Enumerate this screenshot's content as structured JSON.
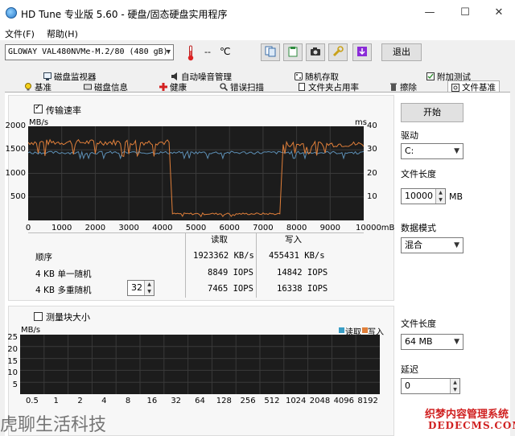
{
  "window": {
    "title": "HD Tune 专业版 5.60 - 硬盘/固态硬盘实用程序",
    "minimize": "—",
    "maximize": "☐",
    "close": "✕"
  },
  "menu": {
    "file": "文件(F)",
    "help": "帮助(H)"
  },
  "toolbar": {
    "drive": "GLOWAY VAL480NVMe-M.2/80 (480 gB)",
    "temperature": "--",
    "exit": "退出"
  },
  "tabs_top": [
    "磁盘监视器",
    "自动噪音管理",
    "随机存取",
    "附加测试"
  ],
  "tabs_bottom": [
    "基准",
    "磁盘信息",
    "健康",
    "错误扫描",
    "文件夹占用率",
    "擦除",
    "文件基准"
  ],
  "transfer": {
    "checkbox_label": "传输速率",
    "unit_left": "MB/s",
    "unit_right": "ms",
    "y_ticks": [
      "2000",
      "1500",
      "1000",
      "500"
    ],
    "y_ticks_right": [
      "40",
      "30",
      "20",
      "10"
    ],
    "x_ticks": [
      "0",
      "1000",
      "2000",
      "3000",
      "4000",
      "5000",
      "6000",
      "7000",
      "8000",
      "9000",
      "10000mB"
    ],
    "colors": {
      "read": "#e07f3a",
      "access": "#5d8fb5",
      "background": "#1c1c1c"
    }
  },
  "results": {
    "col_read": "读取",
    "col_write": "写入",
    "rows": [
      {
        "label": "顺序",
        "read": "1923362 KB/s",
        "write": "455431 KB/s"
      },
      {
        "label": "4 KB 单一随机",
        "read": "8849 IOPS",
        "write": "14842 IOPS"
      },
      {
        "label": "4 KB 多重随机",
        "read": "7465 IOPS",
        "write": "16338 IOPS"
      }
    ],
    "queue_depth": "32"
  },
  "side": {
    "start": "开始",
    "drive_label": "驱动",
    "drive_value": "C:",
    "file_length_label": "文件长度",
    "file_length_value": "10000",
    "file_length_unit": "MB",
    "data_mode_label": "数据模式",
    "data_mode_value": "混合"
  },
  "block": {
    "checkbox_label": "测量块大小",
    "unit": "MB/s",
    "legend_read": "读取",
    "legend_write": "写入",
    "y_ticks": [
      "25",
      "20",
      "15",
      "10",
      "5"
    ],
    "x_ticks": [
      "0.5",
      "1",
      "2",
      "4",
      "8",
      "16",
      "32",
      "64",
      "128",
      "256",
      "512",
      "1024",
      "2048",
      "4096",
      "8192"
    ],
    "file_length_label": "文件长度",
    "file_length_value": "64 MB",
    "delay_label": "延迟",
    "delay_value": "0"
  },
  "watermark": {
    "left": "虎聊生活科技",
    "right_top": "织梦内容管理系统",
    "right_bottom": "DEDECMS.COM"
  }
}
